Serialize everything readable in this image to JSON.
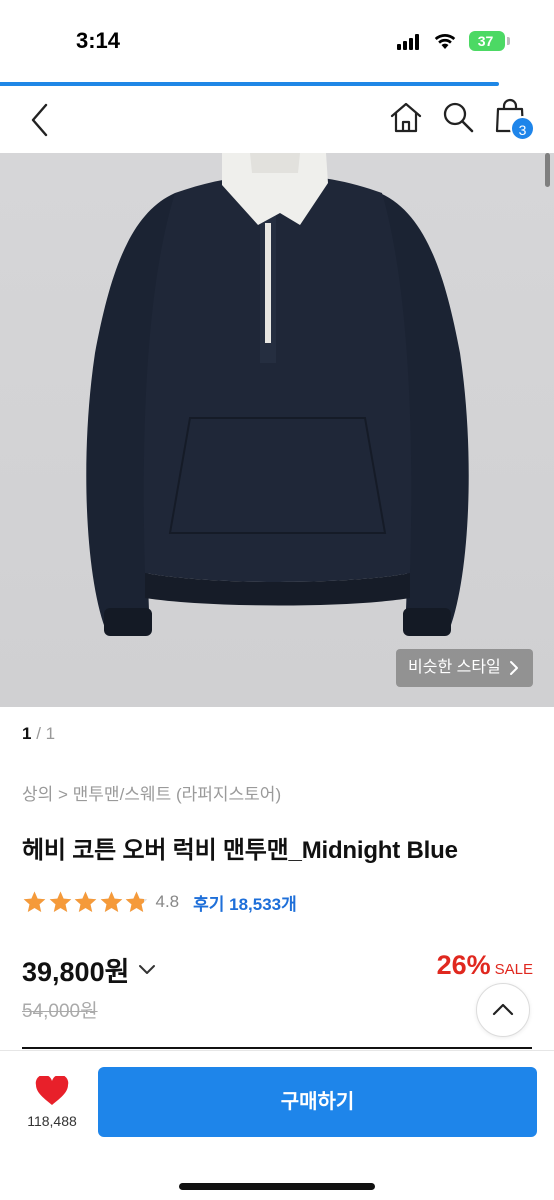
{
  "status_bar": {
    "time": "3:14",
    "battery": "37",
    "battery_color": "#4cd964"
  },
  "load_progress": 0.9,
  "nav": {
    "back_icon": "chevron-left-icon",
    "home_icon": "home-icon",
    "search_icon": "search-icon",
    "cart_icon": "shopping-bag-icon",
    "cart_count": "3",
    "accent": "#1e85ea"
  },
  "product_image": {
    "similar_style_label": "비슷한 스타일",
    "similar_style_icon": "chevron-right-icon"
  },
  "pager": {
    "current": "1",
    "separator": " / ",
    "total": "1"
  },
  "breadcrumb": "상의 > 맨투맨/스웨트 (라퍼지스토어)",
  "product": {
    "title": "헤비 코튼 오버 럭비 맨투맨_Midnight Blue",
    "rating": "4.8",
    "rating_stars": 4.8,
    "review_label": "후기 18,533개",
    "price": "39,800원",
    "price_icon": "chevron-down-icon",
    "discount_rate": "26%",
    "discount_label": "SALE",
    "original_price": "54,000원",
    "sale_color": "#e0281f",
    "star_color": "#f59a3a"
  },
  "scroll_top_icon": "chevron-up-icon",
  "bottom_bar": {
    "like_icon": "heart-icon",
    "like_count": "118,488",
    "buy_label": "구매하기",
    "like_color": "#e8202a"
  }
}
